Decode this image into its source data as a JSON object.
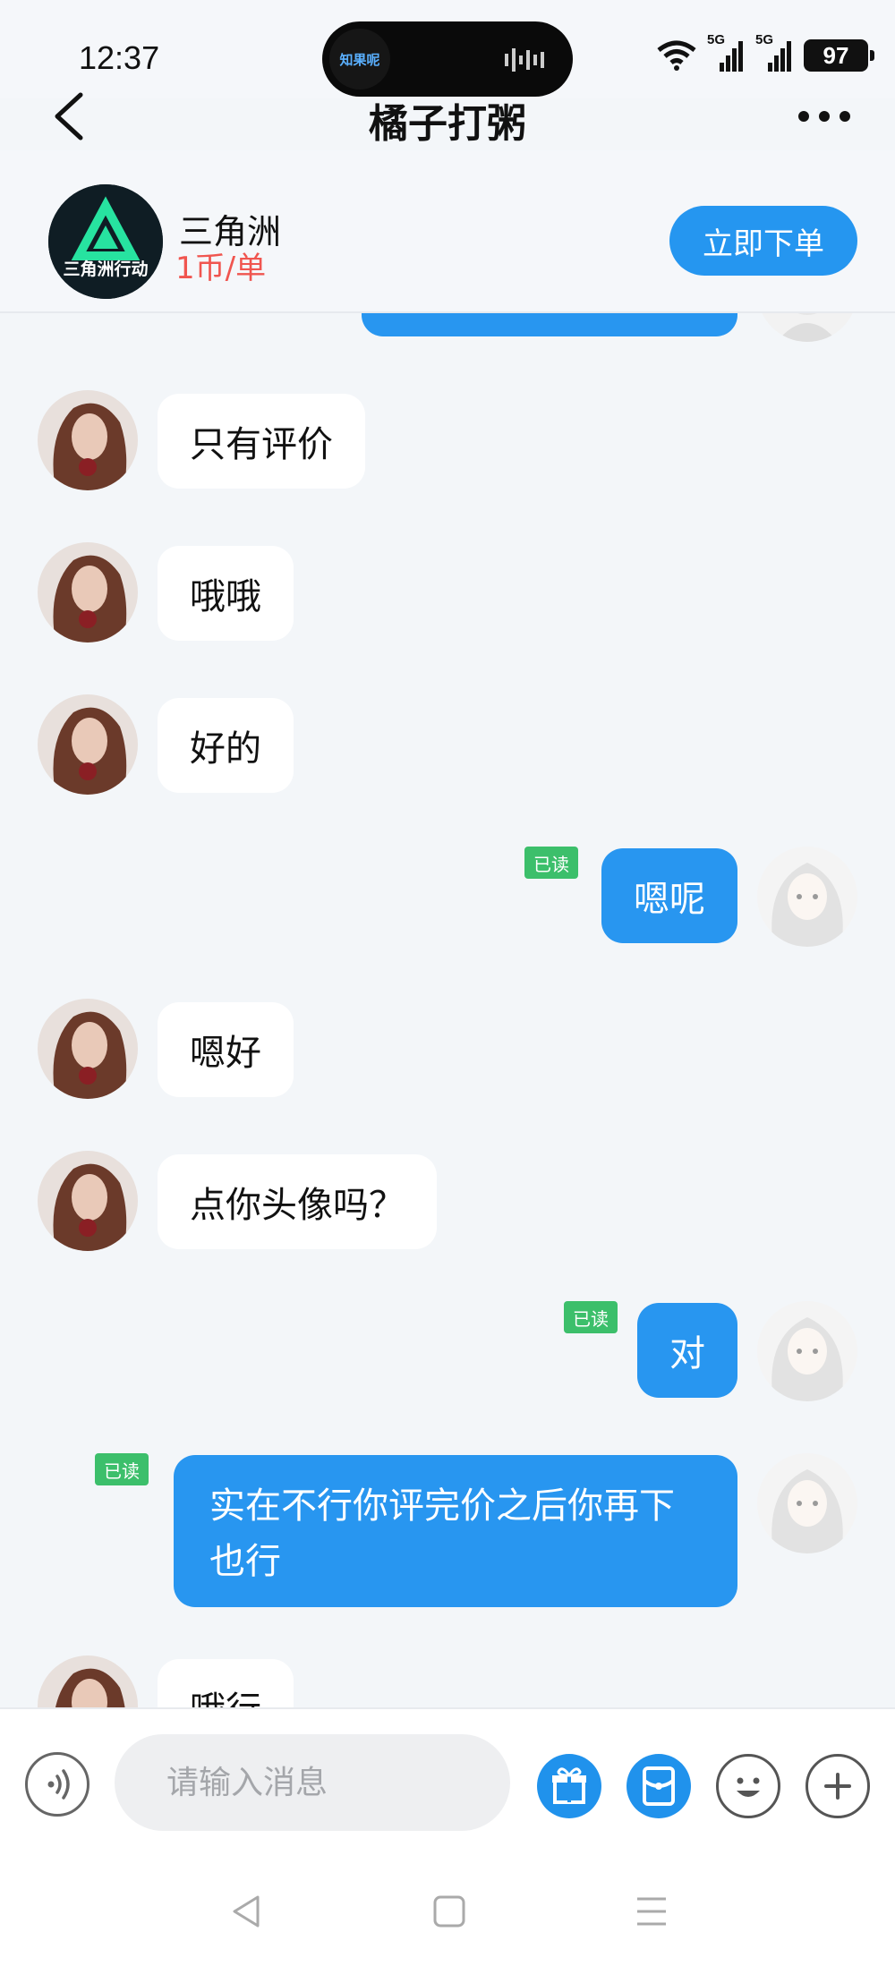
{
  "status_bar": {
    "time": "12:37",
    "island_app_label": "知果呢",
    "network_1": "5G",
    "network_2": "5G",
    "battery": "97"
  },
  "nav": {
    "title": "橘子打粥"
  },
  "game": {
    "logo_text": "三角洲行动",
    "name": "三角洲",
    "price": "1币/单",
    "order_button": "立即下单"
  },
  "messages": [
    {
      "side": "in",
      "text": "只有评价"
    },
    {
      "side": "in",
      "text": "哦哦"
    },
    {
      "side": "in",
      "text": "好的"
    },
    {
      "side": "out",
      "text": "嗯呢",
      "read": "已读"
    },
    {
      "side": "in",
      "text": "嗯好"
    },
    {
      "side": "in",
      "text": "点你头像吗？"
    },
    {
      "side": "out",
      "text": "对",
      "read": "已读"
    },
    {
      "side": "out",
      "text": "实在不行你评完价之后你再下也行",
      "read": "已读"
    },
    {
      "side": "in",
      "text": "哦行"
    }
  ],
  "input": {
    "placeholder": "请输入消息"
  },
  "colors": {
    "accent_blue": "#2896f0",
    "read_green": "#3cbf6b",
    "price_red": "#f0554f",
    "background": "#f3f6f9"
  },
  "icons": [
    "back-arrow-icon",
    "more-dots-icon",
    "voice-icon",
    "gift-icon",
    "red-packet-icon",
    "emoji-icon",
    "plus-icon",
    "wifi-icon",
    "signal-icon",
    "battery-icon",
    "nav-back-icon",
    "nav-home-icon",
    "nav-menu-icon"
  ]
}
